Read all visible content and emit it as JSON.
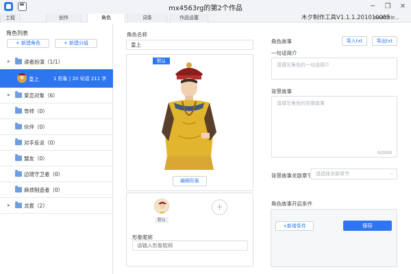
{
  "window": {
    "title": "mx4563rg的第2个作品",
    "version": "木夕制作工具V1.1.1.201010005",
    "user": "mx4563r..."
  },
  "tabs": [
    {
      "label": "工程"
    },
    {
      "label": "创作"
    },
    {
      "label": "角色"
    },
    {
      "label": "词条"
    },
    {
      "label": "作品设置"
    }
  ],
  "sidebar": {
    "title": "角色列表",
    "new_role": "+ 新建角色",
    "new_group": "+ 新建分组",
    "items": [
      {
        "label": "读者扮演（1/1）",
        "arrow": "▶"
      },
      {
        "label": "爱恋对象（6）",
        "arrow": "▶"
      },
      {
        "label": "导师（0）",
        "arrow": ""
      },
      {
        "label": "伙伴（0）",
        "arrow": ""
      },
      {
        "label": "对手反派（0）",
        "arrow": ""
      },
      {
        "label": "盟友（0）",
        "arrow": ""
      },
      {
        "label": "边境守卫者（0）",
        "arrow": ""
      },
      {
        "label": "麻烦制造者（0）",
        "arrow": ""
      },
      {
        "label": "龙套（2）",
        "arrow": "▶"
      }
    ],
    "selected": {
      "name": "皇上",
      "stats": "1 形象  |  20 句话 211 字"
    }
  },
  "editor": {
    "name_label": "角色名称",
    "name_value": "皇上",
    "default_badge": "默认",
    "edit_image": "编辑形象",
    "thumb_label": "默认",
    "add_symbol": "+",
    "image_name_label": "形象昵称",
    "image_name_placeholder": "请输入形象昵称"
  },
  "story": {
    "title": "角色故事",
    "import": "导入txt",
    "export": "导出txt",
    "intro_label": "一句话简介",
    "intro_placeholder": "请填写角色的一句话简介",
    "bg_label": "背景故事",
    "bg_placeholder": "请填写角色的背景故事",
    "counter": "0/2000",
    "chapter_label": "背景故事关联章节",
    "chapter_placeholder": "请选择关联章节",
    "chevron": "⌵",
    "open_label": "角色故事开启条件",
    "add_condition": "+新增条件",
    "save": "保存"
  },
  "colors": {
    "accent": "#2e76f0"
  }
}
